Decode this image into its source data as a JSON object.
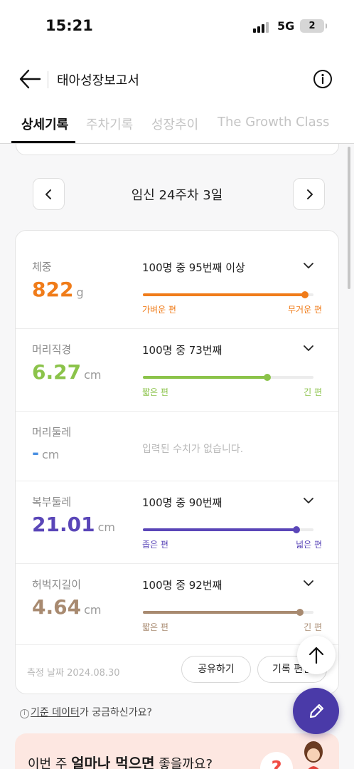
{
  "status_bar": {
    "time": "15:21",
    "network": "5G",
    "battery": "2"
  },
  "header": {
    "title": "태아성장보고서"
  },
  "tabs": [
    {
      "label": "상세기록",
      "active": true
    },
    {
      "label": "주차기록",
      "active": false
    },
    {
      "label": "성장추이",
      "active": false
    },
    {
      "label": "The Growth Class",
      "active": false
    }
  ],
  "week_nav": {
    "label": "임신 24주차 3일"
  },
  "metrics": [
    {
      "name": "체중",
      "value": "822",
      "unit": "g",
      "rank": "100명 중 95번째 이상",
      "percentile": 0.95,
      "color": "#f07c1a",
      "left_label": "가벼운 편",
      "right_label": "무거운 편"
    },
    {
      "name": "머리직경",
      "value": "6.27",
      "unit": "cm",
      "rank": "100명 중 73번째",
      "percentile": 0.73,
      "color": "#8bc34a",
      "left_label": "짧은 편",
      "right_label": "긴 편"
    },
    {
      "name": "머리둘레",
      "value": "-",
      "unit": "cm",
      "no_data": "입력된 수치가 없습니다.",
      "color": "#4a90e2"
    },
    {
      "name": "복부둘레",
      "value": "21.01",
      "unit": "cm",
      "rank": "100명 중 90번째",
      "percentile": 0.9,
      "color": "#5a46b8",
      "left_label": "좁은 편",
      "right_label": "넓은 편"
    },
    {
      "name": "허벅지길이",
      "value": "4.64",
      "unit": "cm",
      "rank": "100명 중 92번째",
      "percentile": 0.92,
      "color": "#a88a70",
      "left_label": "짧은 편",
      "right_label": "긴 편"
    }
  ],
  "footer": {
    "measure_date": "측정 날짜 2024.08.30",
    "share_label": "공유하기",
    "edit_label": "기록 편집"
  },
  "standard": {
    "link": "기준 데이터",
    "text": "가 궁금하신가요?"
  },
  "promo": {
    "prefix": "이번 주 ",
    "bold": "얼마나 먹으면",
    "suffix": " 좋을까요?",
    "badge": "?"
  },
  "colors": {
    "brand": "#4a3aa8"
  }
}
